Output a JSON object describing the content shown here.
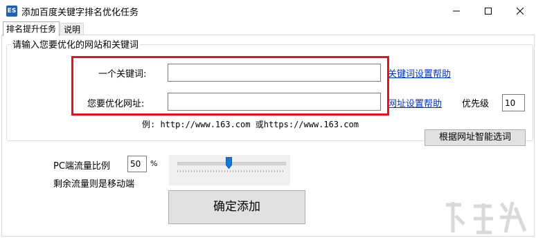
{
  "window": {
    "title": "添加百度关键字排名优化任务",
    "app_icon_text": "ES",
    "controls": [
      "minimize-icon",
      "maximize-icon",
      "close-icon"
    ]
  },
  "tabs": [
    {
      "label": "排名提升任务",
      "active": true
    },
    {
      "label": "说明",
      "active": false
    }
  ],
  "group": {
    "legend": "请输入您要优化的网站和关键词"
  },
  "keyword": {
    "label": "一个关键词:",
    "value": "",
    "help_link": "关键词设置帮助"
  },
  "url": {
    "label": "您要优化网址:",
    "value": "",
    "help_link": "网址设置帮助",
    "priority_label": "优先级",
    "priority_value": "10"
  },
  "example_text": "例: http://www.163.com 或https://www.163.com",
  "smart_select_button": "根据网址智能选词",
  "traffic": {
    "pc_label": "PC端流量比例",
    "pc_value": "50",
    "percent_sign": "%",
    "mobile_note": "剩余流量则是移动端",
    "slider_level_percent": 50
  },
  "confirm_button": "确定添加",
  "colors": {
    "highlight_border": "#e0141e",
    "link": "#0033cc",
    "slider_thumb": "#1976d2"
  }
}
